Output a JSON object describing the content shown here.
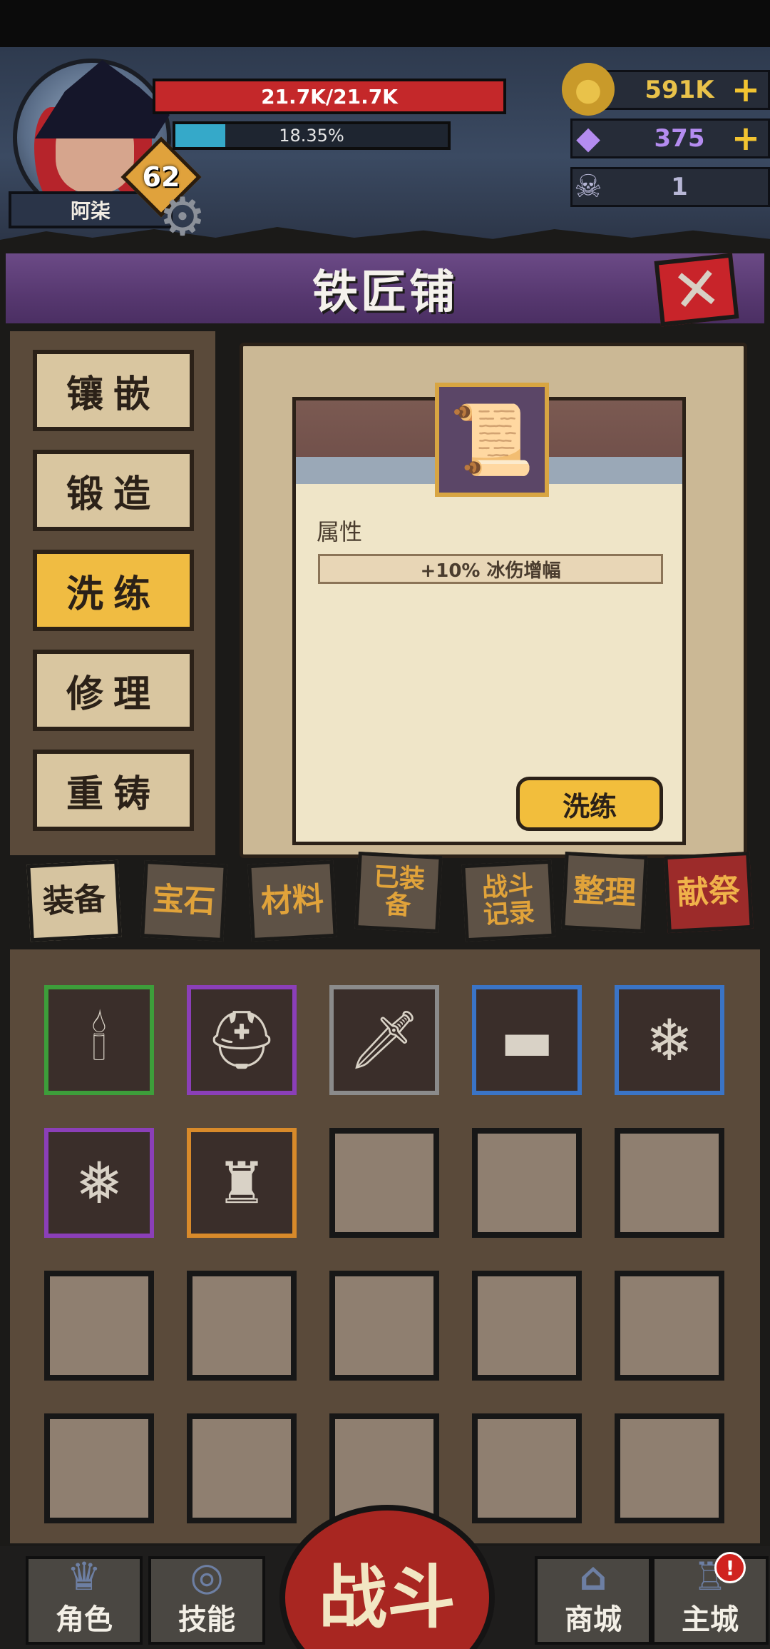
{
  "hud": {
    "player_name": "阿柒",
    "level": "62",
    "hp_text": "21.7K/21.7K",
    "hp_fraction": 1.0,
    "xp_text": "18.35%",
    "xp_fraction": 0.1835,
    "resources": [
      {
        "icon": "gold-coin-icon",
        "value": "591K",
        "plus": "+",
        "color": "#e9c24a"
      },
      {
        "icon": "purple-crystal-icon",
        "value": "375",
        "plus": "+",
        "color": "#b48cf0"
      },
      {
        "icon": "ram-skull-icon",
        "value": "1",
        "plus": "",
        "color": "#b7b7d6"
      }
    ]
  },
  "title": "铁匠铺",
  "close_symbol": "✕",
  "menu": [
    {
      "label": "镶嵌",
      "active": false
    },
    {
      "label": "锻造",
      "active": false
    },
    {
      "label": "洗练",
      "active": true
    },
    {
      "label": "修理",
      "active": false
    },
    {
      "label": "重铸",
      "active": false
    }
  ],
  "detail": {
    "item_icon": "scroll-bracer-icon",
    "attr_label": "属性",
    "attr_value": "+10% 冰伤增幅",
    "action_label": "洗练"
  },
  "tabs": [
    {
      "label": "装备",
      "state": "active"
    },
    {
      "label": "宝石",
      "state": "inactive"
    },
    {
      "label": "材料",
      "state": "inactive"
    },
    {
      "label": "已装\n备",
      "state": "inactive"
    },
    {
      "label": "战斗\n记录",
      "state": "inactive"
    },
    {
      "label": "整理",
      "state": "inactive"
    },
    {
      "label": "献祭",
      "state": "red"
    }
  ],
  "inventory": [
    {
      "icon": "candelabra-icon",
      "rarity_color": "#3d9e3a"
    },
    {
      "icon": "hooded-helmet-icon",
      "rarity_color": "#8b3fb8"
    },
    {
      "icon": "bone-sword-icon",
      "rarity_color": "#8b8b8b"
    },
    {
      "icon": "leather-belt-icon",
      "rarity_color": "#3a74c6"
    },
    {
      "icon": "frost-spear-icon",
      "rarity_color": "#3a74c6"
    },
    {
      "icon": "snowflake-necklace-icon",
      "rarity_color": "#8b3fb8"
    },
    {
      "icon": "dark-cloak-icon",
      "rarity_color": "#d88a2a"
    }
  ],
  "inventory_total_slots": 20,
  "nav": {
    "items": [
      {
        "label": "角色",
        "icon": "helmet-icon"
      },
      {
        "label": "技能",
        "icon": "swirl-icon"
      },
      {
        "label": "商城",
        "icon": "shop-icon"
      },
      {
        "label": "主城",
        "icon": "castle-icon"
      }
    ],
    "battle_label": "战斗",
    "notify": "!"
  }
}
